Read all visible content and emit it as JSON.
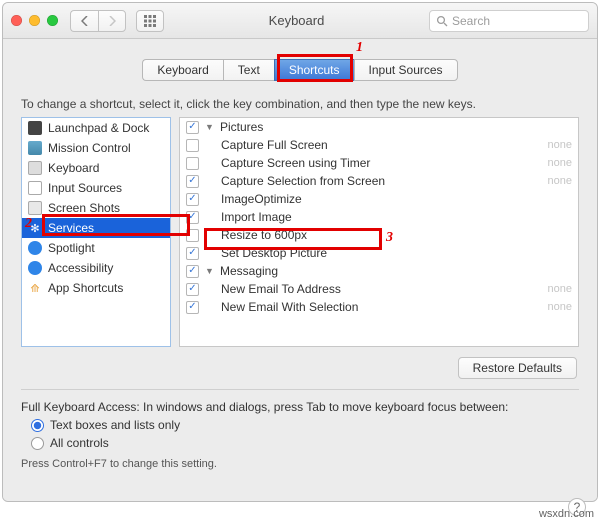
{
  "window": {
    "title": "Keyboard",
    "search_placeholder": "Search"
  },
  "tabs": [
    "Keyboard",
    "Text",
    "Shortcuts",
    "Input Sources"
  ],
  "tabs_active_index": 2,
  "instruction": "To change a shortcut, select it, click the key combination, and then type the new keys.",
  "categories": [
    {
      "icon": "launchpad-icon",
      "label": "Launchpad & Dock"
    },
    {
      "icon": "mission-control-icon",
      "label": "Mission Control"
    },
    {
      "icon": "keyboard-icon",
      "label": "Keyboard"
    },
    {
      "icon": "input-sources-icon",
      "label": "Input Sources"
    },
    {
      "icon": "screenshots-icon",
      "label": "Screen Shots"
    },
    {
      "icon": "services-icon",
      "label": "Services",
      "selected": true
    },
    {
      "icon": "spotlight-icon",
      "label": "Spotlight"
    },
    {
      "icon": "accessibility-icon",
      "label": "Accessibility"
    },
    {
      "icon": "app-shortcuts-icon",
      "label": "App Shortcuts"
    }
  ],
  "shortcuts": {
    "groups": [
      {
        "name": "Pictures",
        "checked": true,
        "items": [
          {
            "label": "Capture Full Screen",
            "checked": false,
            "shortcut": "none"
          },
          {
            "label": "Capture Screen using Timer",
            "checked": false,
            "shortcut": "none"
          },
          {
            "label": "Capture Selection from Screen",
            "checked": true,
            "shortcut": "none"
          },
          {
            "label": "ImageOptimize",
            "checked": true,
            "shortcut": ""
          },
          {
            "label": "Import Image",
            "checked": true,
            "shortcut": ""
          },
          {
            "label": "Resize to 600px",
            "checked": false,
            "shortcut": ""
          },
          {
            "label": "Set Desktop Picture",
            "checked": true,
            "shortcut": ""
          }
        ]
      },
      {
        "name": "Messaging",
        "checked": true,
        "items": [
          {
            "label": "New Email To Address",
            "checked": true,
            "shortcut": "none"
          },
          {
            "label": "New Email With Selection",
            "checked": true,
            "shortcut": "none"
          }
        ]
      }
    ]
  },
  "restore_defaults_label": "Restore Defaults",
  "fka": {
    "heading": "Full Keyboard Access: In windows and dialogs, press Tab to move keyboard focus between:",
    "options": [
      "Text boxes and lists only",
      "All controls"
    ],
    "selected": 0,
    "hint": "Press Control+F7 to change this setting."
  },
  "callouts": {
    "tab": "1",
    "services": "2",
    "resize": "3"
  },
  "watermark": "wsxdn.com"
}
